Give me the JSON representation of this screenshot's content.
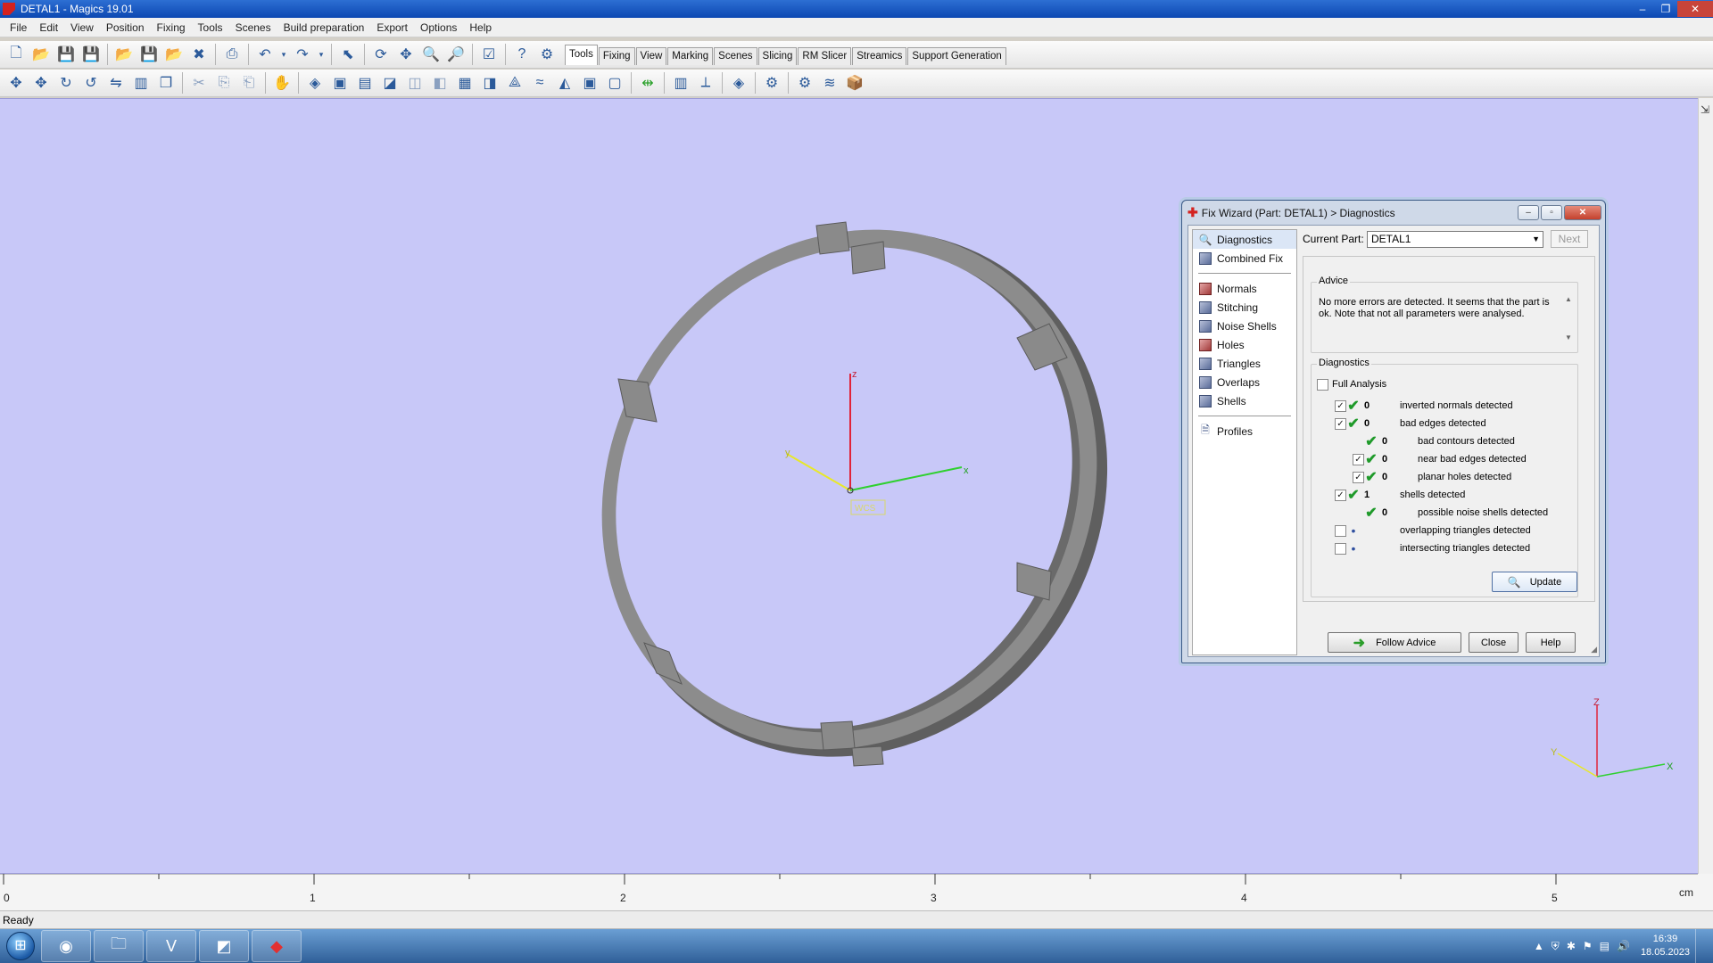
{
  "window": {
    "title": "DETAL1 - Magics 19.01",
    "min": "–",
    "max": "❐",
    "close": "✕"
  },
  "menu": [
    "File",
    "Edit",
    "View",
    "Position",
    "Fixing",
    "Tools",
    "Scenes",
    "Build preparation",
    "Export",
    "Options",
    "Help"
  ],
  "toolbar_tabs": [
    "Tools",
    "Fixing",
    "View",
    "Marking",
    "Scenes",
    "Slicing",
    "RM Slicer",
    "Streamics",
    "Support Generation"
  ],
  "viewport": {
    "bg": "#c8c8f8",
    "axis_labels": {
      "z": "z",
      "y": "y",
      "x": "x"
    },
    "wcs_label": "WCS",
    "corner_axis_labels": {
      "z": "Z",
      "y": "Y",
      "x": "X"
    }
  },
  "ruler": {
    "labels": [
      "0",
      "1",
      "2",
      "3",
      "4",
      "5"
    ],
    "unit": "cm"
  },
  "status": {
    "text": "Ready"
  },
  "taskbar": {
    "time": "16:39",
    "date": "18.05.2023"
  },
  "dialog": {
    "title": "Fix Wizard (Part: DETAL1) > Diagnostics",
    "nav_top": [
      {
        "label": "Diagnostics",
        "icon": "magnifier-icon"
      },
      {
        "label": "Combined Fix",
        "icon": "cube-icon"
      }
    ],
    "nav_tools": [
      {
        "label": "Normals"
      },
      {
        "label": "Stitching"
      },
      {
        "label": "Noise Shells"
      },
      {
        "label": "Holes"
      },
      {
        "label": "Triangles"
      },
      {
        "label": "Overlaps"
      },
      {
        "label": "Shells"
      }
    ],
    "nav_profiles": "Profiles",
    "current_part_label": "Current Part:",
    "current_part_value": "DETAL1",
    "next_label": "Next",
    "advice_label": "Advice",
    "advice_text": "No more errors are detected. It seems that the part is ok. Note that not all parameters were analysed.",
    "diagnostics_label": "Diagnostics",
    "full_analysis_label": "Full Analysis",
    "rows": [
      {
        "label": "inverted normals detected",
        "count": "0"
      },
      {
        "label": "bad edges detected",
        "count": "0"
      },
      {
        "label": "bad contours detected",
        "count": "0"
      },
      {
        "label": "near bad edges detected",
        "count": "0"
      },
      {
        "label": "planar holes detected",
        "count": "0"
      },
      {
        "label": "shells detected",
        "count": "1"
      },
      {
        "label": "possible noise shells detected",
        "count": "0"
      },
      {
        "label": "overlapping triangles detected",
        "count": ""
      },
      {
        "label": "intersecting triangles detected",
        "count": ""
      }
    ],
    "update_label": "Update",
    "follow_advice_label": "Follow Advice",
    "close_label": "Close",
    "help_label": "Help"
  }
}
